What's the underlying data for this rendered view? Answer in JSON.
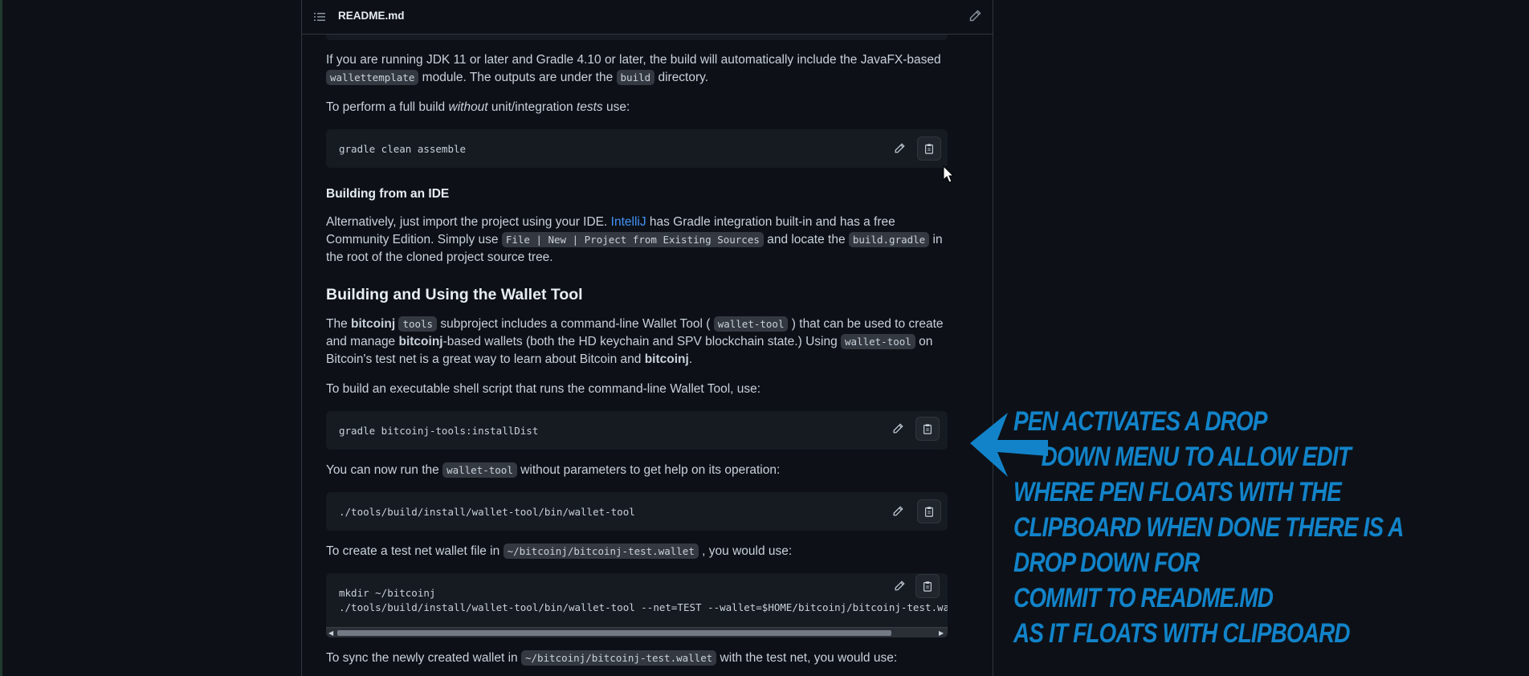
{
  "file_header": {
    "title": "README.md",
    "outline_icon": "list-unordered-icon",
    "edit_icon": "pencil-icon"
  },
  "paragraphs": {
    "p1": {
      "t1": "If you are running JDK 11 or later and Gradle 4.10 or later, the build will automatically include the JavaFX-based ",
      "c1": "wallettemplate",
      "t2": " module. The outputs are under the ",
      "c2": "build",
      "t3": " directory."
    },
    "p2": {
      "t1": "To perform a full build ",
      "em1": "without",
      "t2": " unit/integration ",
      "em2": "tests",
      "t3": " use:"
    },
    "h_ide": "Building from an IDE",
    "p3": {
      "t1": "Alternatively, just import the project using your IDE. ",
      "link": "IntelliJ",
      "t2": " has Gradle integration built-in and has a free Community Edition. Simply use ",
      "c1": "File | New | Project from Existing Sources",
      "t3": " and locate the ",
      "c2": "build.gradle",
      "t4": " in the root of the cloned project source tree."
    },
    "h_tool": "Building and Using the Wallet Tool",
    "p4": {
      "t1": "The ",
      "b1": "bitcoinj",
      "t2": " ",
      "c1": "tools",
      "t3": " subproject includes a command-line Wallet Tool ( ",
      "c2": "wallet-tool",
      "t4": " ) that can be used to create and manage ",
      "b2": "bitcoinj",
      "t5": "-based wallets (both the HD keychain and SPV blockchain state.) Using ",
      "c3": "wallet-tool",
      "t6": " on Bitcoin's test net is a great way to learn about Bitcoin and ",
      "b3": "bitcoinj",
      "t7": "."
    },
    "p5": "To build an executable shell script that runs the command-line Wallet Tool, use:",
    "p6": {
      "t1": "You can now run the ",
      "c1": "wallet-tool",
      "t2": " without parameters to get help on its operation:"
    },
    "p7": {
      "t1": "To create a test net wallet file in ",
      "c1": "~/bitcoinj/bitcoinj-test.wallet",
      "t2": " , you would use:"
    },
    "p8": {
      "t1": "To sync the newly created wallet in ",
      "c1": "~/bitcoinj/bitcoinj-test.wallet",
      "t2": " with the test net, you would use:"
    }
  },
  "code_blocks": {
    "assemble": "gradle clean assemble",
    "install": "gradle bitcoinj-tools:installDist",
    "run": "./tools/build/install/wallet-tool/bin/wallet-tool",
    "create": "mkdir ~/bitcoinj\n./tools/build/install/wallet-tool/bin/wallet-tool --net=TEST --wallet=$HOME/bitcoinj/bitcoinj-test.wa"
  },
  "code_block_icons": {
    "edit": "pencil-icon",
    "copy": "clipboard-icon"
  },
  "scrollbar": {
    "left_arrow": "◀",
    "right_arrow": "▶"
  },
  "annotation": {
    "lines": [
      "PEN ACTIVATES A DROP",
      "     DOWN MENU TO ALLOW EDIT",
      "WHERE PEN FLOATS WITH THE",
      "CLIPBOARD WHEN DONE THERE IS A",
      "DROP DOWN FOR",
      "COMMIT TO README.MD",
      "AS IT FLOATS WITH CLIPBOARD"
    ],
    "color": "#1283c9"
  },
  "colors": {
    "background": "#0d1117",
    "link": "#4493f8",
    "code_bg": "#161b22"
  }
}
